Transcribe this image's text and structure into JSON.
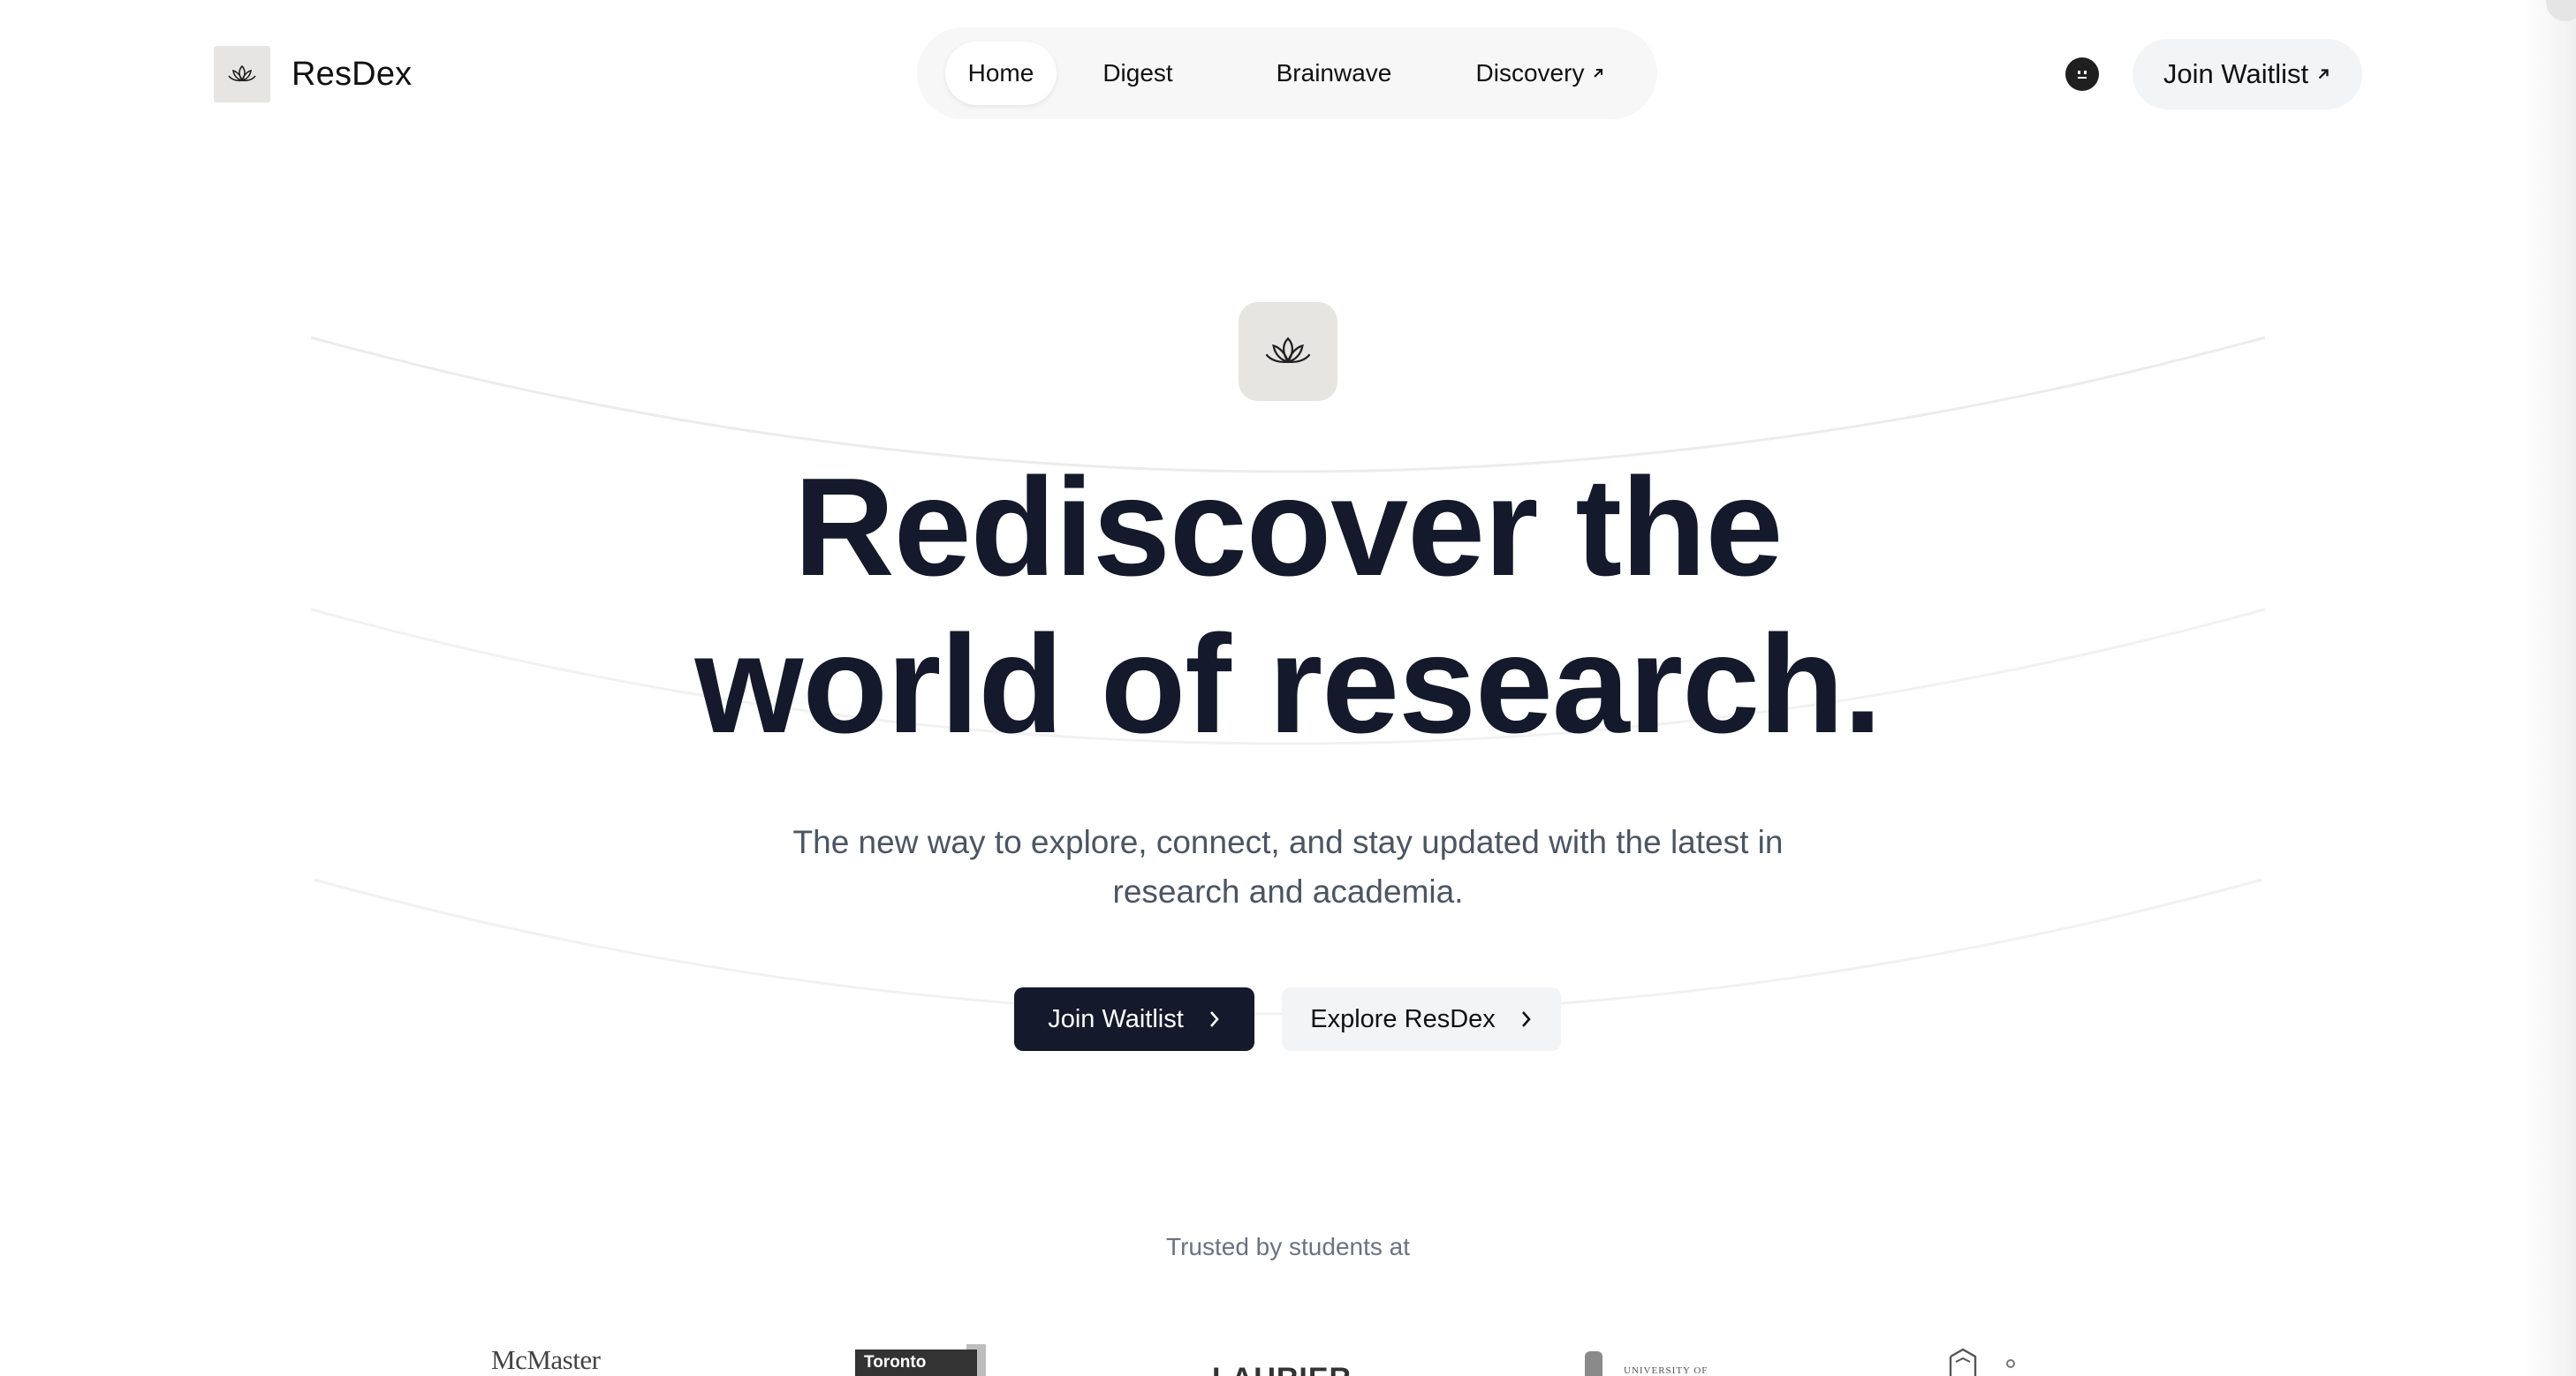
{
  "brand": {
    "name": "ResDex",
    "logo_icon": "lotus-icon"
  },
  "nav": {
    "items": [
      {
        "label": "Home",
        "active": true
      },
      {
        "label": "Digest",
        "active": false
      },
      {
        "label": "Brainwave",
        "active": false
      },
      {
        "label": "Discovery",
        "active": false,
        "external_icon": "arrow-up-right-icon"
      }
    ]
  },
  "header": {
    "avatar_icon": "smiley-face-icon",
    "cta_label": "Join Waitlist",
    "cta_icon": "arrow-up-right-icon"
  },
  "hero": {
    "icon": "lotus-icon",
    "headline_line1": "Rediscover the",
    "headline_line2": "world of research.",
    "subtext": "The new way to explore, connect, and stay updated with the latest in research and academia.",
    "primary_button": "Join Waitlist",
    "secondary_button": "Explore ResDex",
    "button_icon": "chevron-right-icon"
  },
  "trusted": {
    "label": "Trusted by students at",
    "logos": [
      {
        "text": "McMaster"
      },
      {
        "text": "Toronto"
      },
      {
        "text": "LAURIER"
      },
      {
        "text": "UNIVERSITY OF"
      },
      {
        "text": ""
      }
    ]
  },
  "colors": {
    "primary_dark": "#141a2b",
    "surface": "#f3f4f6",
    "icon_tile": "#e7e5e2",
    "muted_text": "#6b7280"
  }
}
